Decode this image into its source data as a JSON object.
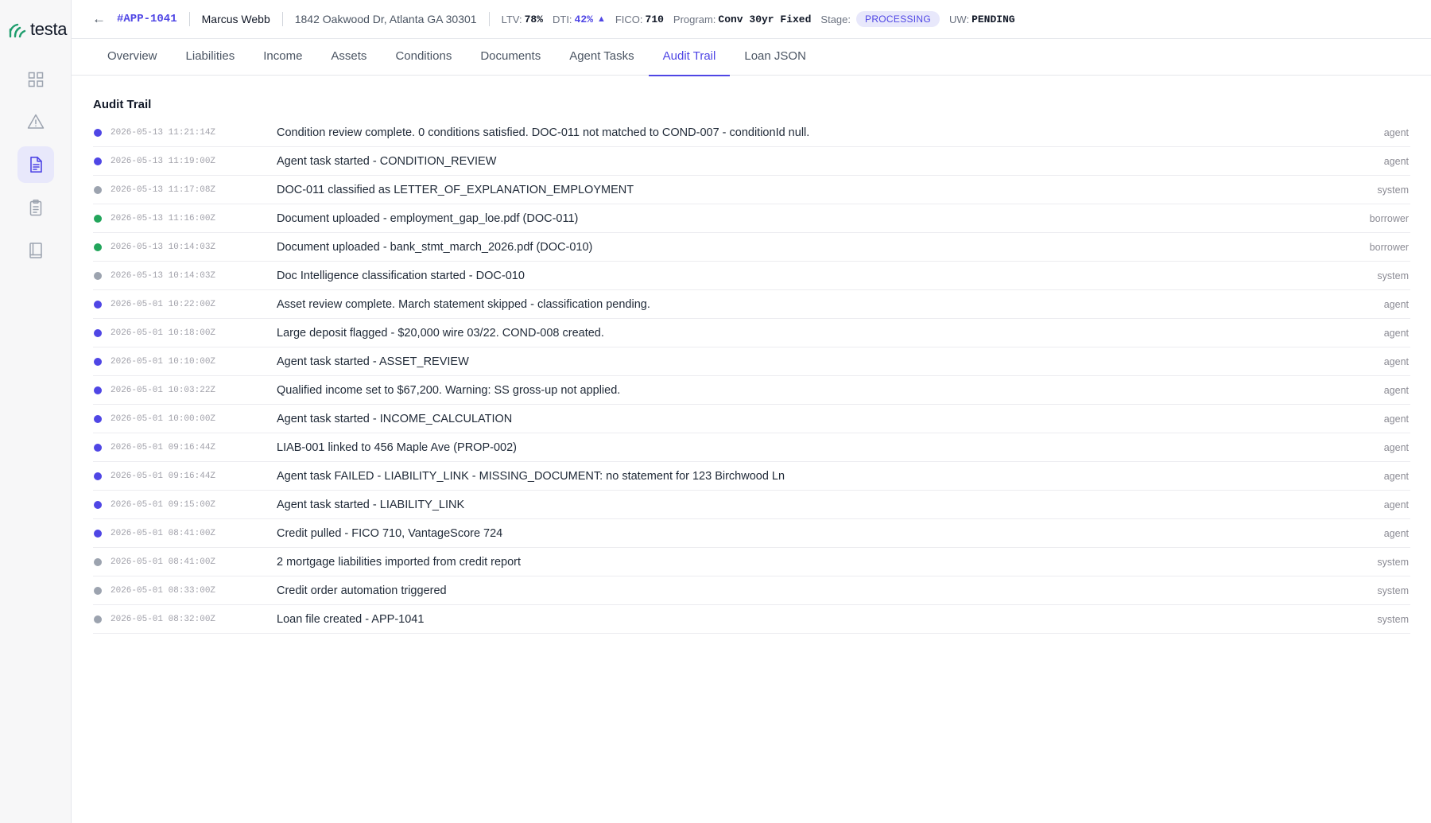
{
  "brand": {
    "name": "testa",
    "color": "#1f9e6e"
  },
  "colors": {
    "accent": "#4f46e5",
    "agent": "#4f46e5",
    "system": "#9ca3af",
    "borrower": "#22a55b"
  },
  "sidebar": {
    "items": [
      {
        "icon": "grid-icon"
      },
      {
        "icon": "warning-icon"
      },
      {
        "icon": "document-icon",
        "active": true
      },
      {
        "icon": "clipboard-icon"
      },
      {
        "icon": "book-icon"
      }
    ]
  },
  "header": {
    "back_label": "←",
    "app_id": "#APP-1041",
    "borrower": "Marcus Webb",
    "address": "1842 Oakwood Dr, Atlanta GA 30301",
    "ltv_label": "LTV:",
    "ltv_value": "78%",
    "dti_label": "DTI:",
    "dti_value": "42%",
    "dti_indicator": "▲",
    "fico_label": "FICO:",
    "fico_value": "710",
    "program_label": "Program:",
    "program_value": "Conv 30yr Fixed",
    "stage_label": "Stage:",
    "stage_value": "PROCESSING",
    "uw_label": "UW:",
    "uw_value": "PENDING"
  },
  "tabs": [
    {
      "label": "Overview"
    },
    {
      "label": "Liabilities"
    },
    {
      "label": "Income"
    },
    {
      "label": "Assets"
    },
    {
      "label": "Conditions"
    },
    {
      "label": "Documents"
    },
    {
      "label": "Agent Tasks"
    },
    {
      "label": "Audit Trail",
      "active": true
    },
    {
      "label": "Loan JSON"
    }
  ],
  "audit": {
    "title": "Audit Trail",
    "entries": [
      {
        "ts": "2026-05-13 11:21:14Z",
        "msg": "Condition review complete. 0 conditions satisfied. DOC-011 not matched to COND-007 - conditionId null.",
        "actor": "agent"
      },
      {
        "ts": "2026-05-13 11:19:00Z",
        "msg": "Agent task started - CONDITION_REVIEW",
        "actor": "agent"
      },
      {
        "ts": "2026-05-13 11:17:08Z",
        "msg": "DOC-011 classified as LETTER_OF_EXPLANATION_EMPLOYMENT",
        "actor": "system"
      },
      {
        "ts": "2026-05-13 11:16:00Z",
        "msg": "Document uploaded - employment_gap_loe.pdf (DOC-011)",
        "actor": "borrower"
      },
      {
        "ts": "2026-05-13 10:14:03Z",
        "msg": "Document uploaded - bank_stmt_march_2026.pdf (DOC-010)",
        "actor": "borrower"
      },
      {
        "ts": "2026-05-13 10:14:03Z",
        "msg": "Doc Intelligence classification started - DOC-010",
        "actor": "system"
      },
      {
        "ts": "2026-05-01 10:22:00Z",
        "msg": "Asset review complete. March statement skipped - classification pending.",
        "actor": "agent"
      },
      {
        "ts": "2026-05-01 10:18:00Z",
        "msg": "Large deposit flagged - $20,000 wire 03/22. COND-008 created.",
        "actor": "agent"
      },
      {
        "ts": "2026-05-01 10:10:00Z",
        "msg": "Agent task started - ASSET_REVIEW",
        "actor": "agent"
      },
      {
        "ts": "2026-05-01 10:03:22Z",
        "msg": "Qualified income set to $67,200. Warning: SS gross-up not applied.",
        "actor": "agent"
      },
      {
        "ts": "2026-05-01 10:00:00Z",
        "msg": "Agent task started - INCOME_CALCULATION",
        "actor": "agent"
      },
      {
        "ts": "2026-05-01 09:16:44Z",
        "msg": "LIAB-001 linked to 456 Maple Ave (PROP-002)",
        "actor": "agent"
      },
      {
        "ts": "2026-05-01 09:16:44Z",
        "msg": "Agent task FAILED - LIABILITY_LINK - MISSING_DOCUMENT: no statement for 123 Birchwood Ln",
        "actor": "agent"
      },
      {
        "ts": "2026-05-01 09:15:00Z",
        "msg": "Agent task started - LIABILITY_LINK",
        "actor": "agent"
      },
      {
        "ts": "2026-05-01 08:41:00Z",
        "msg": "Credit pulled - FICO 710, VantageScore 724",
        "actor": "agent"
      },
      {
        "ts": "2026-05-01 08:41:00Z",
        "msg": "2 mortgage liabilities imported from credit report",
        "actor": "system"
      },
      {
        "ts": "2026-05-01 08:33:00Z",
        "msg": "Credit order automation triggered",
        "actor": "system"
      },
      {
        "ts": "2026-05-01 08:32:00Z",
        "msg": "Loan file created - APP-1041",
        "actor": "system"
      }
    ]
  }
}
